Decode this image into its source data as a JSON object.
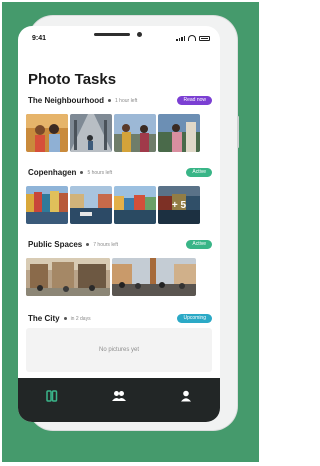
{
  "status": {
    "time": "9:41"
  },
  "page": {
    "title": "Photo Tasks"
  },
  "sections": [
    {
      "name": "The Neighbourhood",
      "time": "1 hour left",
      "badge": "Read now",
      "badge_color": "#7b3fd3"
    },
    {
      "name": "Copenhagen",
      "time": "5 hours left",
      "badge": "Active",
      "badge_color": "#39b587",
      "more": "+ 5"
    },
    {
      "name": "Public Spaces",
      "time": "7 hours left",
      "badge": "Active",
      "badge_color": "#39b587"
    },
    {
      "name": "The City",
      "time": "in 2 days",
      "badge": "Upcoming",
      "badge_color": "#2ba9c6",
      "empty": "No pictures yet"
    }
  ],
  "tabbar": {
    "items": [
      {
        "icon": "photos-icon",
        "color": "#3ab58a"
      },
      {
        "icon": "people-icon",
        "color": "#ffffff"
      },
      {
        "icon": "profile-icon",
        "color": "#ffffff"
      }
    ]
  }
}
